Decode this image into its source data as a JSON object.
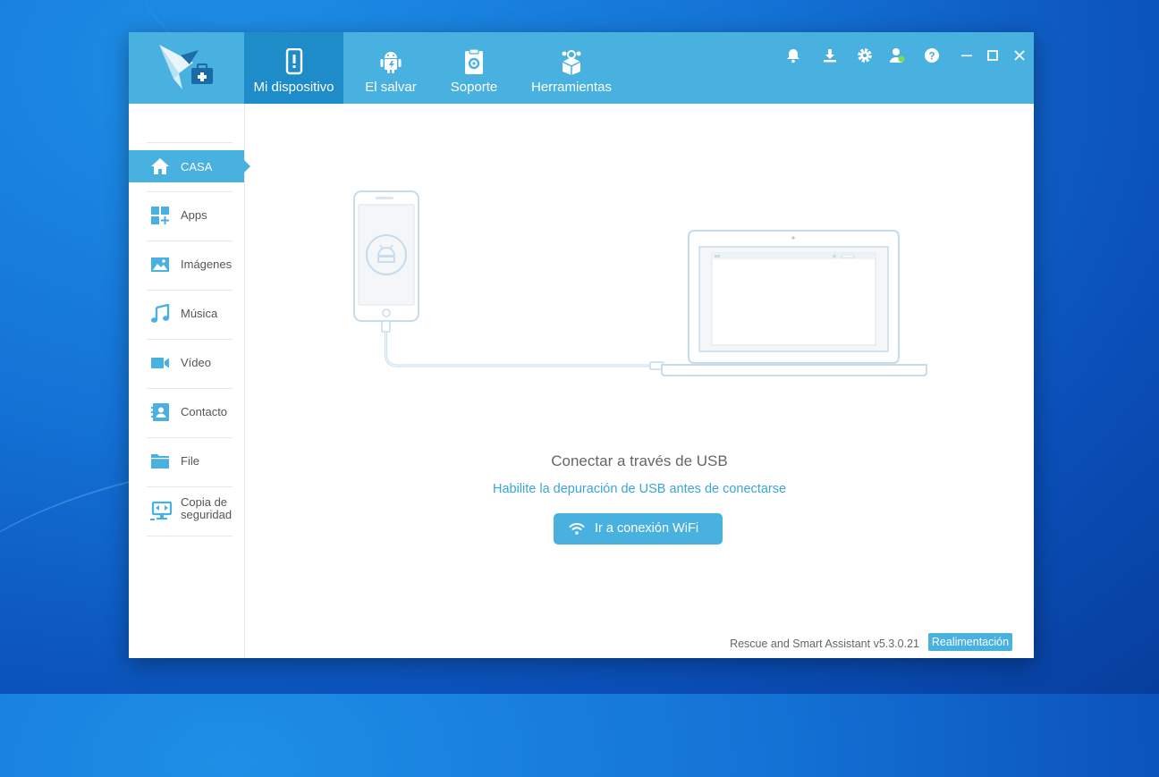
{
  "colors": {
    "accent": "#48b1e0",
    "accent_dark": "#1d8cc8",
    "link": "#3aa5d8"
  },
  "tabs": [
    {
      "label": "Mi dispositivo",
      "icon": "phone-alert-icon",
      "active": true
    },
    {
      "label": "El salvar",
      "icon": "android-icon"
    },
    {
      "label": "Soporte",
      "icon": "support-clipboard-icon"
    },
    {
      "label": "Herramientas",
      "icon": "toolbox-icon"
    }
  ],
  "window_controls": [
    "bell-icon",
    "download-icon",
    "gear-icon",
    "user-icon",
    "help-icon",
    "minimize-icon",
    "maximize-icon",
    "close-icon"
  ],
  "sidebar": {
    "items": [
      {
        "label": "CASA",
        "icon": "home-icon",
        "active": true
      },
      {
        "label": "Apps",
        "icon": "apps-grid-icon"
      },
      {
        "label": "Imágenes",
        "icon": "image-icon"
      },
      {
        "label": "Música",
        "icon": "music-note-icon"
      },
      {
        "label": "Vídeo",
        "icon": "video-camera-icon"
      },
      {
        "label": "Contacto",
        "icon": "contact-book-icon"
      },
      {
        "label": "File",
        "icon": "folder-icon"
      },
      {
        "label": "Copia de seguridad",
        "icon": "backup-monitor-icon"
      }
    ]
  },
  "main": {
    "title": "Conectar a través de USB",
    "subtitle": "Habilite la depuración de USB antes de conectarse",
    "wifi_button": "Ir a conexión WiFi"
  },
  "footer": {
    "version": "Rescue and Smart Assistant v5.3.0.21",
    "feedback": "Realimentación"
  }
}
